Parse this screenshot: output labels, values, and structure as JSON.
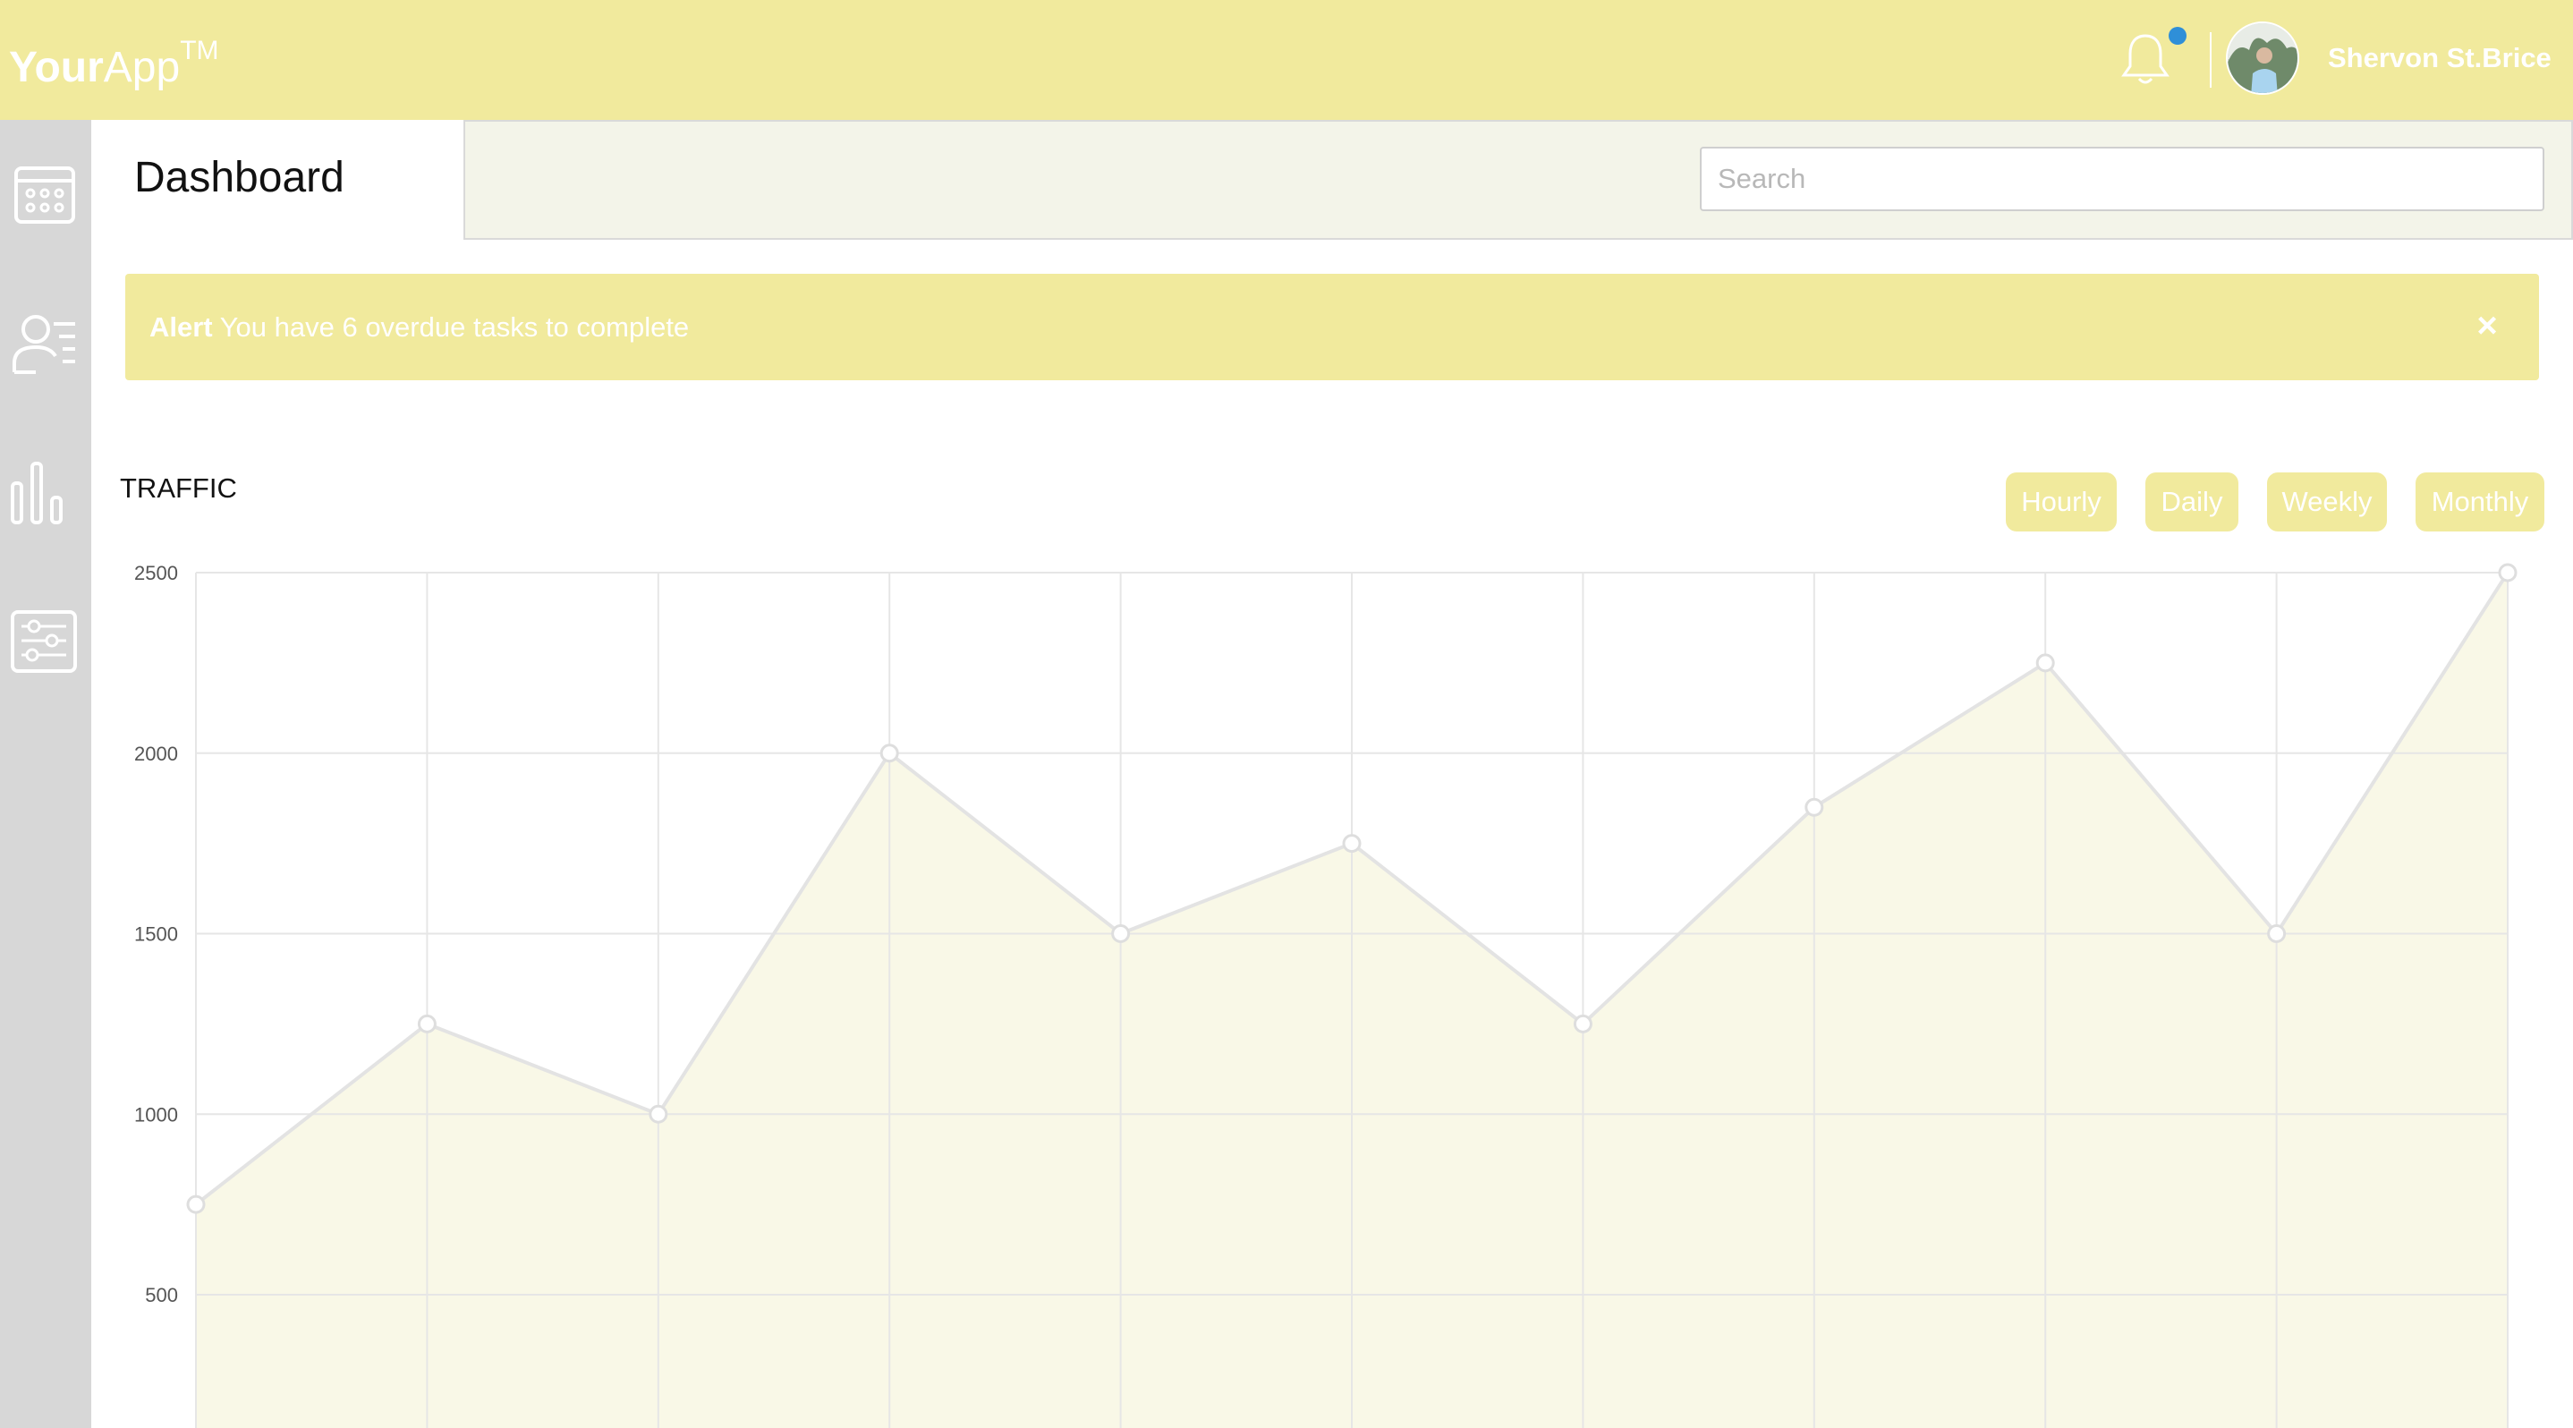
{
  "header": {
    "logo_bold": "Your",
    "logo_light": "App",
    "logo_tm": "TM",
    "user_name": "Shervon St.Brice",
    "has_notification": true,
    "notification_dot_color": "#2f8fd8"
  },
  "sidebar": {
    "items": [
      {
        "icon": "calendar-icon"
      },
      {
        "icon": "user-list-icon"
      },
      {
        "icon": "bar-chart-icon"
      },
      {
        "icon": "sliders-icon"
      }
    ]
  },
  "page": {
    "title": "Dashboard"
  },
  "search": {
    "placeholder": "Search"
  },
  "alert": {
    "label": "Alert",
    "message": "You have 6 overdue tasks to complete",
    "close": "×"
  },
  "traffic": {
    "title": "TRAFFIC",
    "ranges": [
      "Hourly",
      "Daily",
      "Weekly",
      "Monthly"
    ]
  },
  "colors": {
    "accent": "#f1ea9d",
    "sidebar": "#d7d7d7",
    "chart_fill": "#f9f8e7",
    "chart_line": "#e3e3e3"
  },
  "chart_data": {
    "type": "area",
    "title": "TRAFFIC",
    "xlabel": "",
    "ylabel": "",
    "y_ticks": [
      2500,
      2000,
      1500,
      1000,
      500
    ],
    "ylim": [
      0,
      2500
    ],
    "grid": true,
    "series": [
      {
        "values": [
          750,
          1250,
          1000,
          2000,
          1500,
          1750,
          1250,
          1850,
          2250,
          1500,
          2500
        ]
      }
    ]
  }
}
